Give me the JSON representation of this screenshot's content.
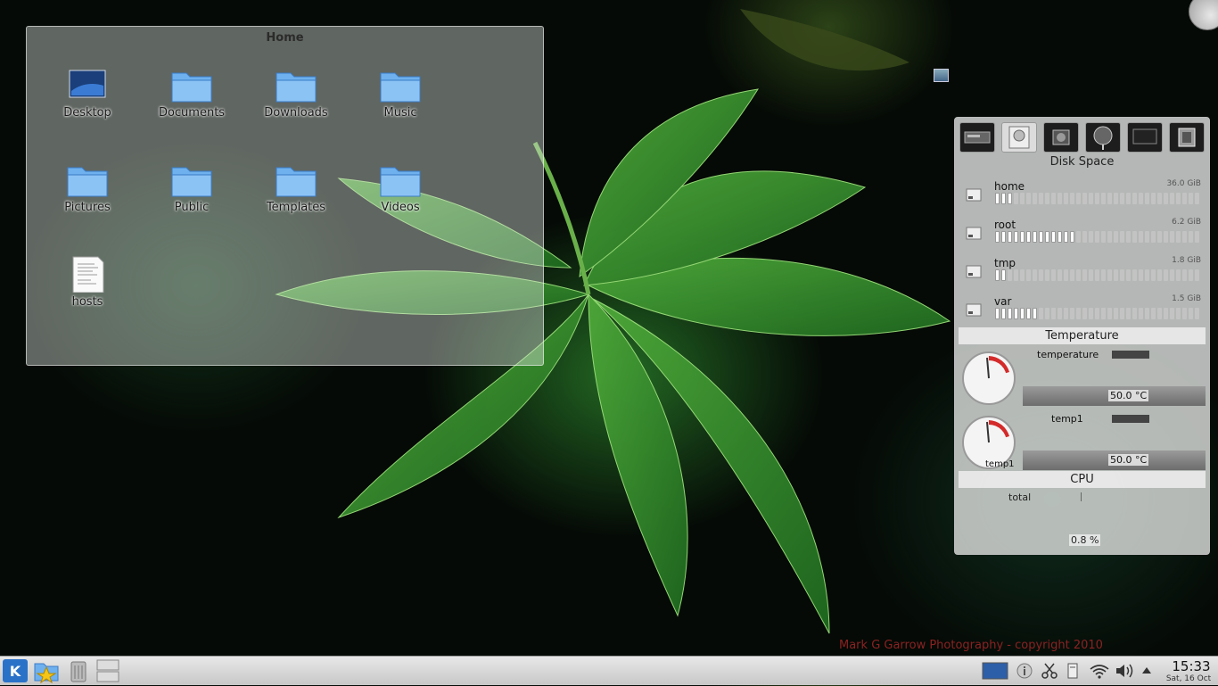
{
  "folderview": {
    "title": "Home",
    "items": [
      {
        "label": "Desktop",
        "icon": "desktop-icon"
      },
      {
        "label": "Documents",
        "icon": "folder-icon"
      },
      {
        "label": "Downloads",
        "icon": "folder-icon"
      },
      {
        "label": "Music",
        "icon": "folder-icon"
      },
      {
        "label": "Pictures",
        "icon": "folder-icon"
      },
      {
        "label": "Public",
        "icon": "folder-icon"
      },
      {
        "label": "Templates",
        "icon": "folder-icon"
      },
      {
        "label": "Videos",
        "icon": "folder-icon"
      },
      {
        "label": "hosts",
        "icon": "text-file-icon"
      }
    ]
  },
  "sysmon": {
    "tabs": [
      "hard-disk-icon",
      "drive-icon",
      "hardware-icon",
      "network-globe-icon",
      "monitor-icon",
      "cpu-chip-icon"
    ],
    "disk": {
      "header": "Disk Space",
      "rows": [
        {
          "name": "home",
          "size": "36.0 GiB",
          "used_fraction": 0.1
        },
        {
          "name": "root",
          "size": "6.2 GiB",
          "used_fraction": 0.38
        },
        {
          "name": "tmp",
          "size": "1.8 GiB",
          "used_fraction": 0.07
        },
        {
          "name": "var",
          "size": "1.5 GiB",
          "used_fraction": 0.22
        }
      ]
    },
    "temperature": {
      "header": "Temperature",
      "sensors": [
        {
          "name": "temperature",
          "value": "50.0 °C",
          "gauge_label": ""
        },
        {
          "name": "temp1",
          "value": "50.0 °C",
          "gauge_label": "temp1"
        }
      ]
    },
    "cpu": {
      "header": "CPU",
      "label": "total",
      "value": "0.8 %"
    }
  },
  "wallpaper": {
    "credit": "Mark G Garrow Photography - copyright 2010"
  },
  "taskbar": {
    "launchers": [
      "kde-menu-icon",
      "favorites-folder-icon",
      "trash-icon",
      "pager-icon"
    ],
    "tray": [
      "screen-icon",
      "info-icon",
      "klipper-scissors-icon",
      "device-notifier-icon",
      "wifi-icon",
      "volume-icon",
      "expand-arrow-icon"
    ],
    "clock": {
      "time": "15:33",
      "date": "Sat, 16 Oct"
    }
  },
  "colors": {
    "folder_blue": "#6fb1ee",
    "disk_bar_fill": "#ffffff",
    "credit_red": "#8a2222"
  }
}
